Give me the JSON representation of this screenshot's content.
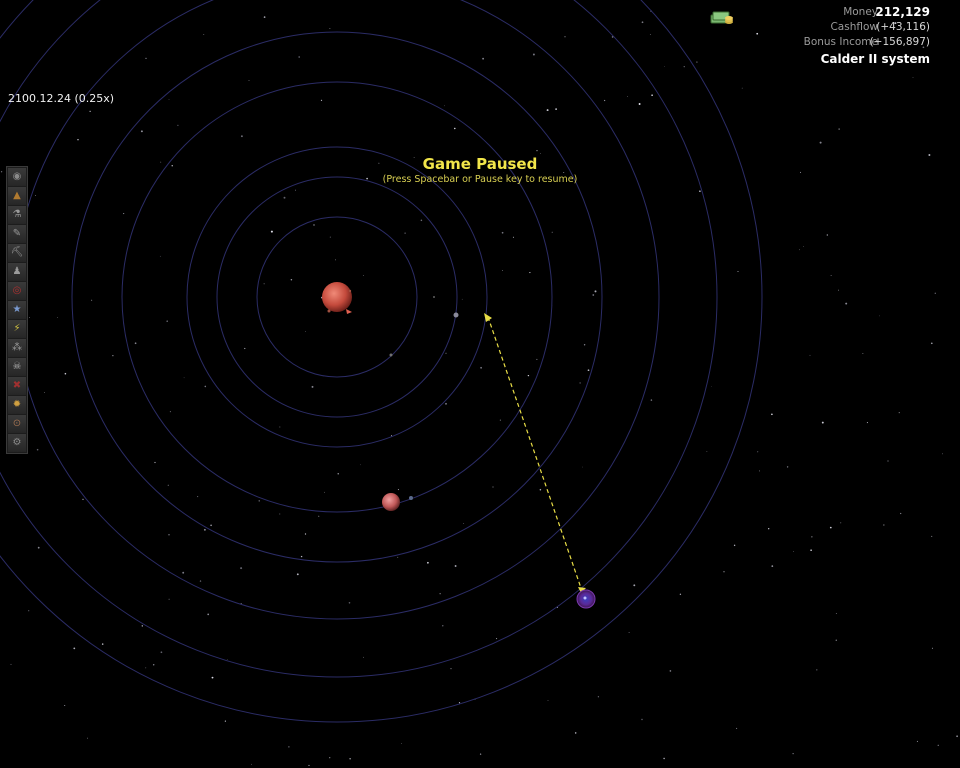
{
  "hud": {
    "money_label": "Money",
    "money_value": "212,129",
    "cashflow_label": "Cashflow",
    "cashflow_value": "(+43,116)",
    "bonus_label": "Bonus Income",
    "bonus_value": "(+156,897)",
    "system_name": "Calder II system",
    "money_icon": "money-stack-icon"
  },
  "date_display": "2100.12.24  (0.25x)",
  "pause": {
    "title": "Game Paused",
    "hint": "(Press Spacebar or Pause key to resume)"
  },
  "toolbar": {
    "items": [
      {
        "name": "planet-view-icon",
        "glyph": "◉",
        "color": "#8a8a8a"
      },
      {
        "name": "colony-icon",
        "glyph": "▲",
        "color": "#b07a30"
      },
      {
        "name": "research-icon",
        "glyph": "⚗",
        "color": "#9a9a9a"
      },
      {
        "name": "ship-design-icon",
        "glyph": "✎",
        "color": "#9a9a9a"
      },
      {
        "name": "mining-icon",
        "glyph": "⛏",
        "color": "#9a9a9a"
      },
      {
        "name": "personnel-icon",
        "glyph": "♟",
        "color": "#9a9a9a"
      },
      {
        "name": "military-icon",
        "glyph": "◎",
        "color": "#b03030"
      },
      {
        "name": "star-icon",
        "glyph": "★",
        "color": "#7a9ad0"
      },
      {
        "name": "energy-icon",
        "glyph": "⚡",
        "color": "#d0c040"
      },
      {
        "name": "fleet-icon",
        "glyph": "⁂",
        "color": "#9a9a9a"
      },
      {
        "name": "pirate-icon",
        "glyph": "☠",
        "color": "#b0b0b0"
      },
      {
        "name": "diplomacy-icon",
        "glyph": "✖",
        "color": "#a03030"
      },
      {
        "name": "idea-icon",
        "glyph": "✹",
        "color": "#d0a040"
      },
      {
        "name": "galaxy-icon",
        "glyph": "⊙",
        "color": "#a07050"
      },
      {
        "name": "settings-icon",
        "glyph": "⚙",
        "color": "#8a8a8a"
      }
    ]
  },
  "colors": {
    "orbit": "#2b2c66",
    "route": "#e8dd46",
    "star": "#d2584a",
    "planet": "#c76060",
    "fleet": "#5a2a9a"
  }
}
